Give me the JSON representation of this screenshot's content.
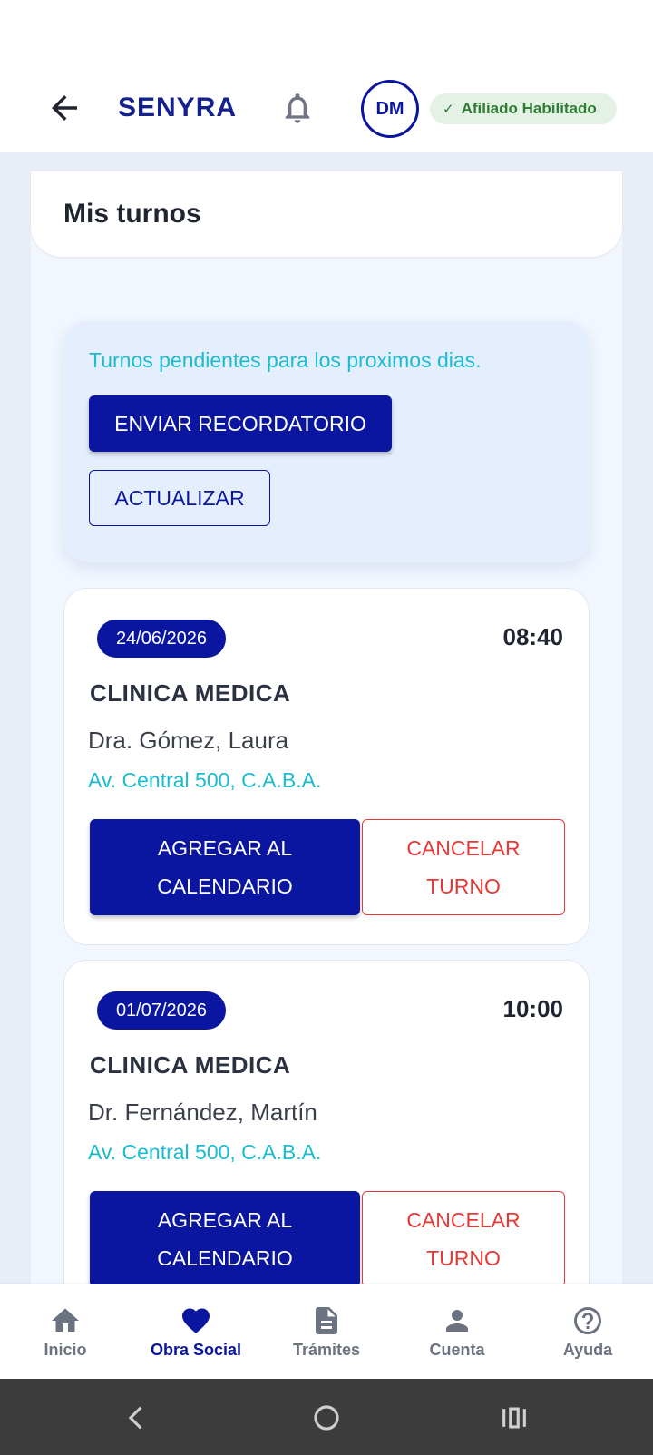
{
  "header": {
    "brand": "SENYRA",
    "avatar_initials": "DM",
    "status_badge": "Afiliado Habilitado",
    "icons": [
      "back-arrow-icon",
      "bell-icon",
      "check-icon"
    ]
  },
  "page": {
    "title": "Mis turnos"
  },
  "info_box": {
    "text": "Turnos pendientes para los proximos dias.",
    "send_reminder_label": "ENVIAR RECORDATORIO",
    "refresh_label": "ACTUALIZAR"
  },
  "appointments": [
    {
      "date": "24/06/2026",
      "time": "08:40",
      "specialty": "CLINICA MEDICA",
      "doctor": "Dra. Gómez, Laura",
      "address": "Av. Central 500, C.A.B.A.",
      "add_calendar_label": "AGREGAR AL\nCALENDARIO",
      "cancel_label": "CANCELAR\nTURNO"
    },
    {
      "date": "01/07/2026",
      "time": "10:00",
      "specialty": "CLINICA MEDICA",
      "doctor": "Dr. Fernández, Martín",
      "address": "Av. Central 500, C.A.B.A.",
      "add_calendar_label": "AGREGAR AL\nCALENDARIO",
      "cancel_label": "CANCELAR\nTURNO"
    }
  ],
  "bottom_nav": {
    "active": "Obra Social",
    "items": [
      {
        "label": "Inicio",
        "icon": "home-icon"
      },
      {
        "label": "Obra Social",
        "icon": "heart-icon"
      },
      {
        "label": "Trámites",
        "icon": "document-icon"
      },
      {
        "label": "Cuenta",
        "icon": "person-icon"
      },
      {
        "label": "Ayuda",
        "icon": "help-icon"
      }
    ]
  },
  "colors": {
    "primary": "#0a169f",
    "accent_text": "#19bcd0",
    "danger": "#e53935",
    "success_badge_bg": "#e4f2e6",
    "success_badge_text": "#2e7d32"
  }
}
